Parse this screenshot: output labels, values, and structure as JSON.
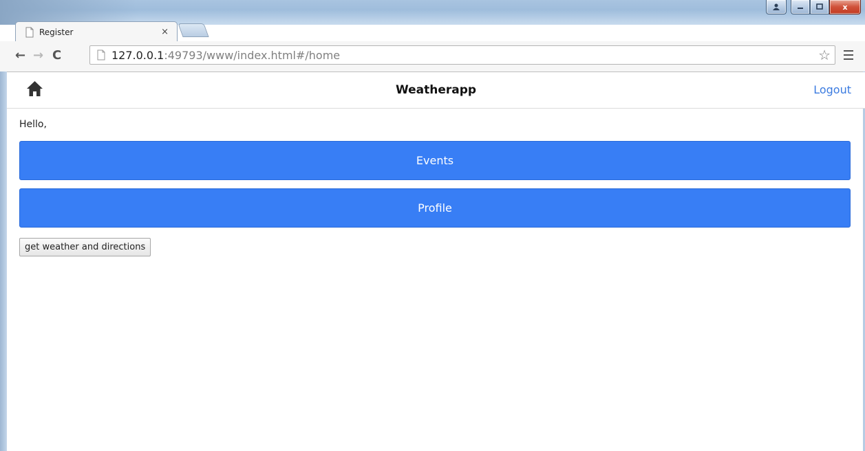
{
  "browser": {
    "tab_title": "Register",
    "tab_close": "×",
    "url_host": "127.0.0.1",
    "url_rest": ":49793/www/index.html#/home",
    "window_controls": {
      "close": "x"
    }
  },
  "header": {
    "title": "Weatherapp",
    "logout_label": "Logout"
  },
  "main": {
    "greeting": "Hello,",
    "events_label": "Events",
    "profile_label": "Profile",
    "weather_button_label": "get weather and directions"
  },
  "colors": {
    "primary_button": "#387ef5",
    "logout_link": "#3b7be0"
  },
  "icons": {
    "home": "home-icon",
    "menu": "menu-icon",
    "star": "bookmark-star-icon"
  }
}
